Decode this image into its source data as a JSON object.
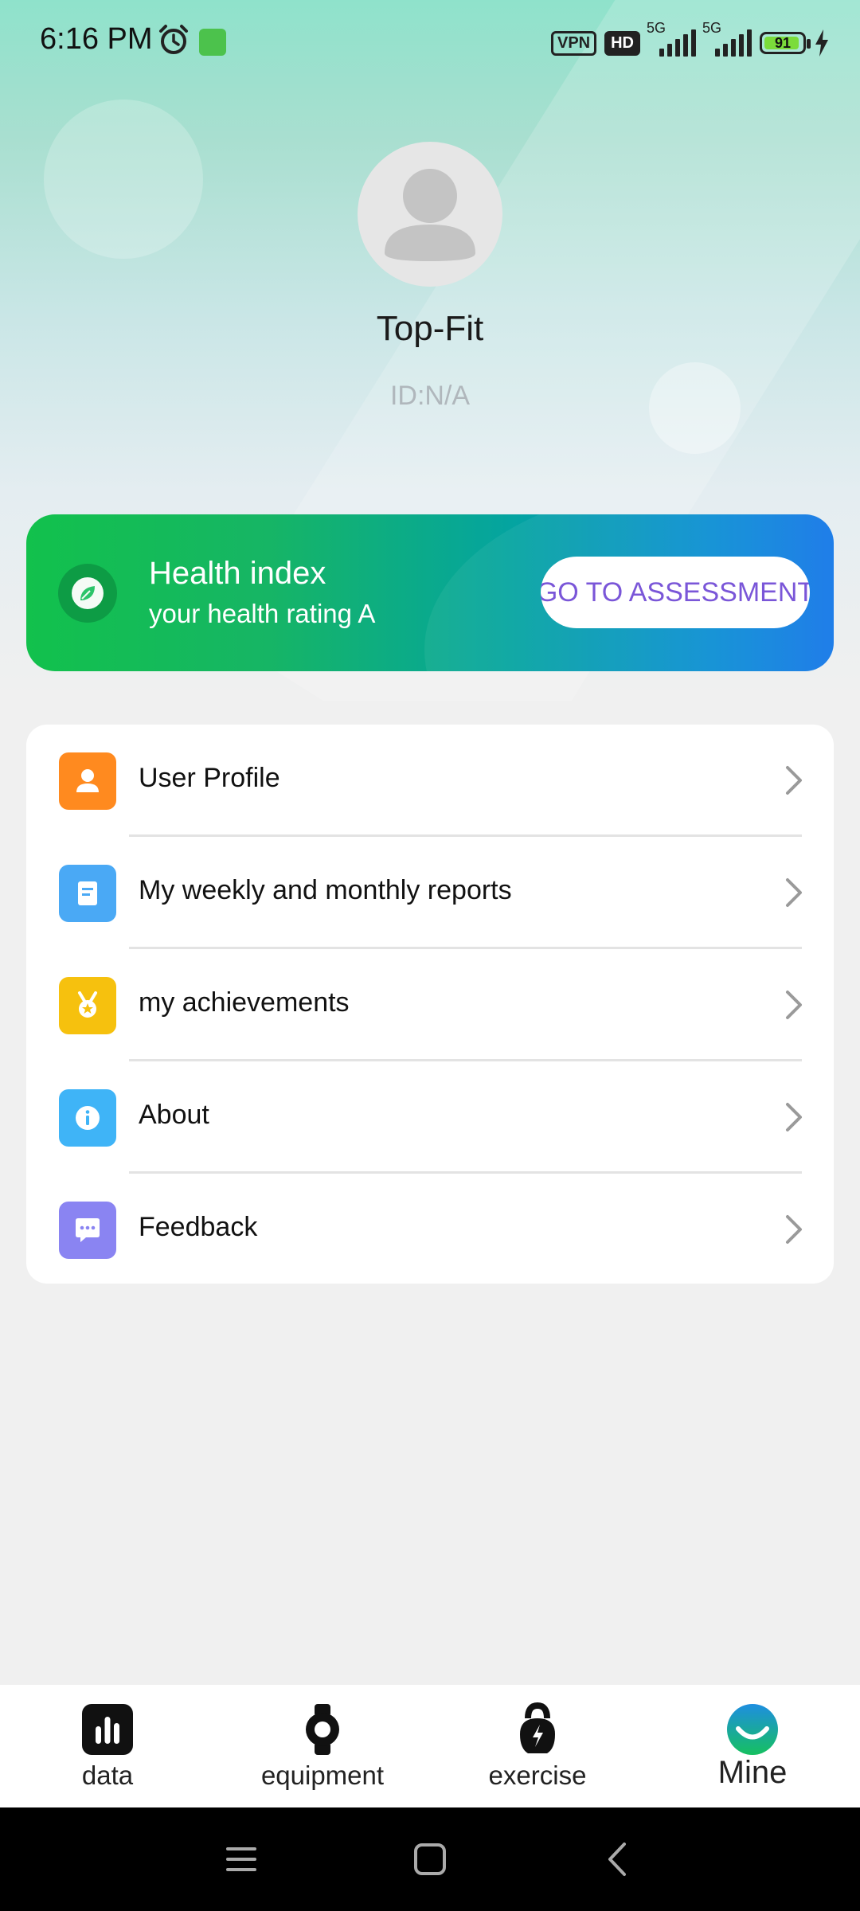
{
  "status_bar": {
    "time": "6:16 PM",
    "vpn": "VPN",
    "hd": "HD",
    "net1": "5G",
    "net2": "5G",
    "battery": "91"
  },
  "profile": {
    "name": "Top-Fit",
    "id": "ID:N/A"
  },
  "health_card": {
    "title": "Health index",
    "subtitle": "your health rating A",
    "button": "GO TO ASSESSMENT"
  },
  "menu": {
    "items": [
      {
        "label": "User Profile",
        "icon": "user-icon",
        "color": "#ff8a1f"
      },
      {
        "label": "My weekly and monthly reports",
        "icon": "report-icon",
        "color": "#4aa9f5"
      },
      {
        "label": "my achievements",
        "icon": "medal-icon",
        "color": "#f6c10e"
      },
      {
        "label": "About",
        "icon": "info-icon",
        "color": "#3fb4f7"
      },
      {
        "label": "Feedback",
        "icon": "chat-icon",
        "color": "#8a84f2"
      }
    ]
  },
  "bottom_nav": {
    "tabs": [
      {
        "label": "data",
        "icon": "bar-chart-icon"
      },
      {
        "label": "equipment",
        "icon": "watch-icon"
      },
      {
        "label": "exercise",
        "icon": "kettlebell-icon"
      },
      {
        "label": "Mine",
        "icon": "smile-icon",
        "active": true
      }
    ]
  },
  "colors": {
    "accent": "#7a56d8",
    "health_gradient_start": "#12c14c",
    "health_gradient_end": "#1276e8"
  }
}
